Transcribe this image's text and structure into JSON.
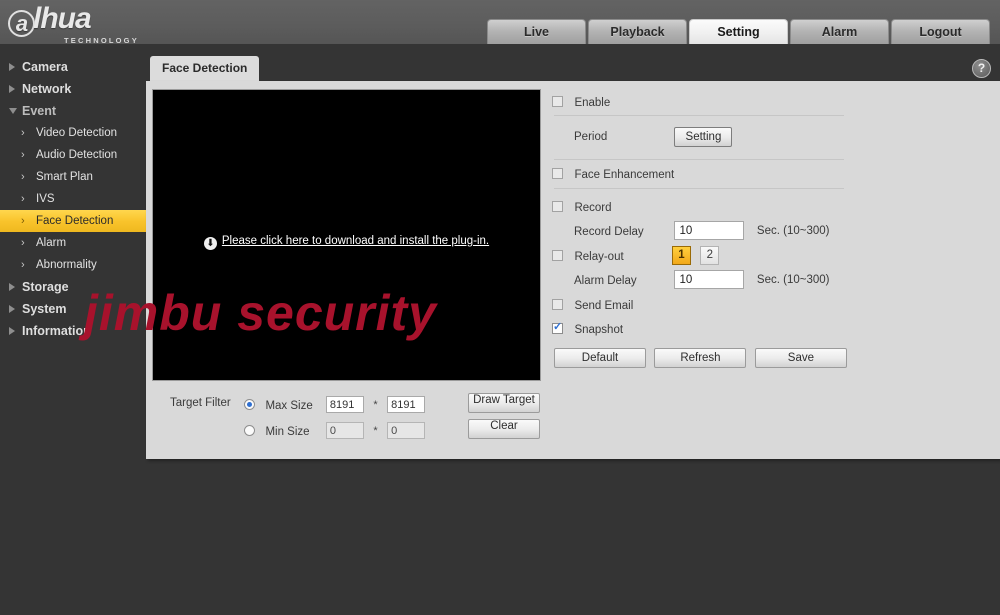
{
  "brand": {
    "name_a": "a",
    "name_rest": "lhua",
    "tagline": "TECHNOLOGY"
  },
  "nav": {
    "tabs": [
      {
        "label": "Live",
        "active": false
      },
      {
        "label": "Playback",
        "active": false
      },
      {
        "label": "Setting",
        "active": true
      },
      {
        "label": "Alarm",
        "active": false
      },
      {
        "label": "Logout",
        "active": false
      }
    ]
  },
  "sidebar": {
    "groups": [
      {
        "label": "Camera",
        "state": "collapsed"
      },
      {
        "label": "Network",
        "state": "collapsed"
      },
      {
        "label": "Event",
        "state": "expanded"
      }
    ],
    "event_items": [
      {
        "label": "Video Detection",
        "selected": false
      },
      {
        "label": "Audio Detection",
        "selected": false
      },
      {
        "label": "Smart Plan",
        "selected": false
      },
      {
        "label": "IVS",
        "selected": false
      },
      {
        "label": "Face Detection",
        "selected": true
      },
      {
        "label": "Alarm",
        "selected": false
      },
      {
        "label": "Abnormality",
        "selected": false
      }
    ],
    "groups_bottom": [
      {
        "label": "Storage",
        "state": "collapsed"
      },
      {
        "label": "System",
        "state": "collapsed"
      },
      {
        "label": "Information",
        "state": "collapsed"
      }
    ]
  },
  "panel": {
    "tab_label": "Face Detection",
    "help_glyph": "?",
    "help_name": "help-icon"
  },
  "video": {
    "plugin_text": "Please click here to download and install the plug-in.",
    "download_glyph": "⬇"
  },
  "watermark": {
    "text": "jimbu security",
    "color": "#a8122c"
  },
  "target_filter": {
    "label": "Target Filter",
    "max": {
      "label": "Max Size",
      "selected": true,
      "width": "8191",
      "height": "8191"
    },
    "min": {
      "label": "Min Size",
      "selected": false,
      "width": "0",
      "height": "0"
    },
    "separator": "*",
    "draw_button": "Draw Target",
    "clear_button": "Clear"
  },
  "form": {
    "enable": {
      "label": "Enable",
      "checked": false
    },
    "period": {
      "label": "Period",
      "button": "Setting"
    },
    "face_enhancement": {
      "label": "Face Enhancement",
      "checked": false
    },
    "record": {
      "label": "Record",
      "checked": false
    },
    "record_delay": {
      "label": "Record Delay",
      "value": "10",
      "unit": "Sec. (10~300)"
    },
    "relay_out": {
      "label": "Relay-out",
      "checked": false,
      "channels": [
        {
          "label": "1",
          "active": true
        },
        {
          "label": "2",
          "active": false
        }
      ]
    },
    "alarm_delay": {
      "label": "Alarm Delay",
      "value": "10",
      "unit": "Sec. (10~300)"
    },
    "send_email": {
      "label": "Send Email",
      "checked": false
    },
    "snapshot": {
      "label": "Snapshot",
      "checked": true
    },
    "actions": [
      {
        "label": "Default"
      },
      {
        "label": "Refresh"
      },
      {
        "label": "Save"
      }
    ]
  }
}
